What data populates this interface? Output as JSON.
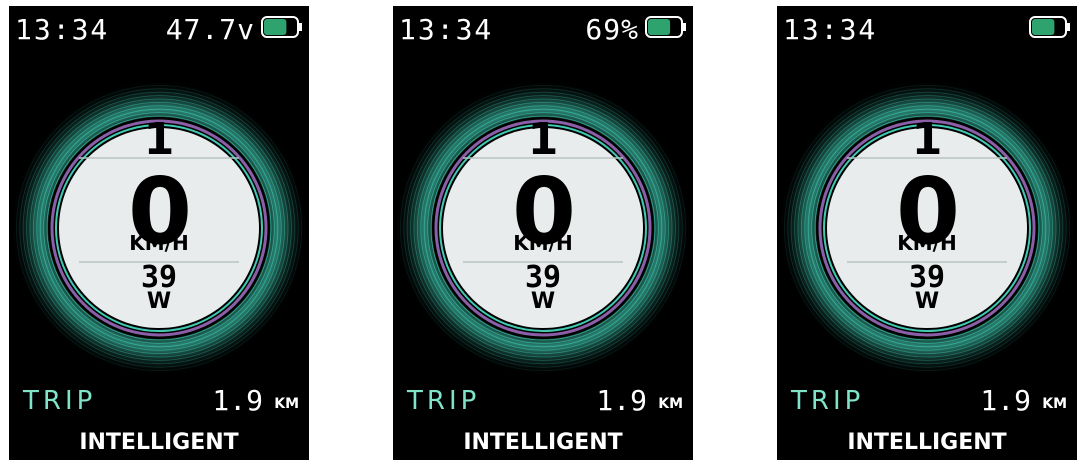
{
  "screens": [
    {
      "time": "13:34",
      "status_reading": "47.7v",
      "battery_level": 0.7,
      "gear": "1",
      "speed": "0",
      "speed_unit": "KM/H",
      "power": "39",
      "power_unit": "W",
      "trip_label": "TRIP",
      "trip_value": "1.9",
      "trip_unit": "KM",
      "mode": "INTELLIGENT"
    },
    {
      "time": "13:34",
      "status_reading": "69%",
      "battery_level": 0.69,
      "gear": "1",
      "speed": "0",
      "speed_unit": "KM/H",
      "power": "39",
      "power_unit": "W",
      "trip_label": "TRIP",
      "trip_value": "1.9",
      "trip_unit": "KM",
      "mode": "INTELLIGENT"
    },
    {
      "time": "13:34",
      "status_reading": "",
      "battery_level": 0.7,
      "gear": "1",
      "speed": "0",
      "speed_unit": "KM/H",
      "power": "39",
      "power_unit": "W",
      "trip_label": "TRIP",
      "trip_value": "1.9",
      "trip_unit": "KM",
      "mode": "INTELLIGENT"
    }
  ],
  "colors": {
    "background": "#000000",
    "dial_face": "#e8ecec",
    "glow_teal": "#3fc9b0",
    "ring_purple": "#8a5fa8",
    "trip_label": "#7fe4c8",
    "battery_fill": "#2fa36e",
    "text": "#ffffff"
  },
  "icons": [
    "battery-icon"
  ]
}
